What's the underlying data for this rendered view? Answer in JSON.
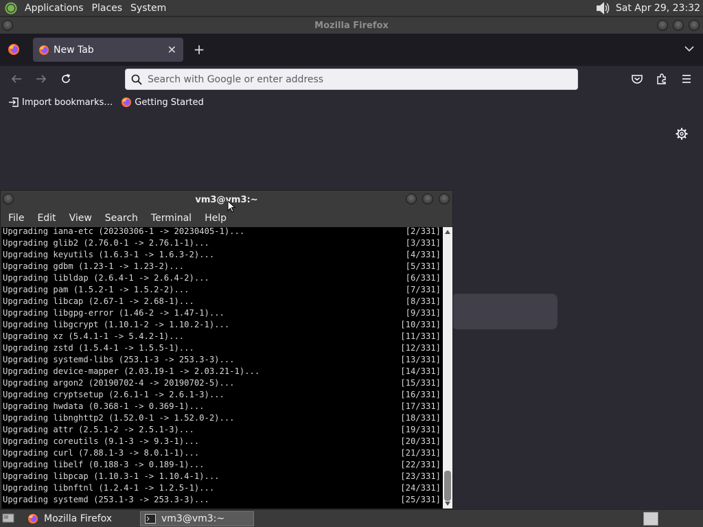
{
  "top_panel": {
    "menus": [
      "Applications",
      "Places",
      "System"
    ],
    "clock": "Sat Apr 29, 23:32"
  },
  "firefox": {
    "window_title": "Mozilla Firefox",
    "tab_label": "New Tab",
    "url_placeholder": "Search with Google or enter address",
    "bookmarks": [
      "Import bookmarks…",
      "Getting Started"
    ]
  },
  "terminal": {
    "window_title": "vm3@vm3:~",
    "menus": [
      "File",
      "Edit",
      "View",
      "Search",
      "Terminal",
      "Help"
    ],
    "lines": [
      {
        "msg": "Upgrading iana-etc (20230306-1 -> 20230405-1)...",
        "count": "[2/331]"
      },
      {
        "msg": "Upgrading glib2 (2.76.0-1 -> 2.76.1-1)...",
        "count": "[3/331]"
      },
      {
        "msg": "Upgrading keyutils (1.6.3-1 -> 1.6.3-2)...",
        "count": "[4/331]"
      },
      {
        "msg": "Upgrading gdbm (1.23-1 -> 1.23-2)...",
        "count": "[5/331]"
      },
      {
        "msg": "Upgrading libldap (2.6.4-1 -> 2.6.4-2)...",
        "count": "[6/331]"
      },
      {
        "msg": "Upgrading pam (1.5.2-1 -> 1.5.2-2)...",
        "count": "[7/331]"
      },
      {
        "msg": "Upgrading libcap (2.67-1 -> 2.68-1)...",
        "count": "[8/331]"
      },
      {
        "msg": "Upgrading libgpg-error (1.46-2 -> 1.47-1)...",
        "count": "[9/331]"
      },
      {
        "msg": "Upgrading libgcrypt (1.10.1-2 -> 1.10.2-1)...",
        "count": "[10/331]"
      },
      {
        "msg": "Upgrading xz (5.4.1-1 -> 5.4.2-1)...",
        "count": "[11/331]"
      },
      {
        "msg": "Upgrading zstd (1.5.4-1 -> 1.5.5-1)...",
        "count": "[12/331]"
      },
      {
        "msg": "Upgrading systemd-libs (253.1-3 -> 253.3-3)...",
        "count": "[13/331]"
      },
      {
        "msg": "Upgrading device-mapper (2.03.19-1 -> 2.03.21-1)...",
        "count": "[14/331]"
      },
      {
        "msg": "Upgrading argon2 (20190702-4 -> 20190702-5)...",
        "count": "[15/331]"
      },
      {
        "msg": "Upgrading cryptsetup (2.6.1-1 -> 2.6.1-3)...",
        "count": "[16/331]"
      },
      {
        "msg": "Upgrading hwdata (0.368-1 -> 0.369-1)...",
        "count": "[17/331]"
      },
      {
        "msg": "Upgrading libnghttp2 (1.52.0-1 -> 1.52.0-2)...",
        "count": "[18/331]"
      },
      {
        "msg": "Upgrading attr (2.5.1-2 -> 2.5.1-3)...",
        "count": "[19/331]"
      },
      {
        "msg": "Upgrading coreutils (9.1-3 -> 9.3-1)...",
        "count": "[20/331]"
      },
      {
        "msg": "Upgrading curl (7.88.1-3 -> 8.0.1-1)...",
        "count": "[21/331]"
      },
      {
        "msg": "Upgrading libelf (0.188-3 -> 0.189-1)...",
        "count": "[22/331]"
      },
      {
        "msg": "Upgrading libpcap (1.10.3-1 -> 1.10.4-1)...",
        "count": "[23/331]"
      },
      {
        "msg": "Upgrading libnftnl (1.2.4-1 -> 1.2.5-1)...",
        "count": "[24/331]"
      },
      {
        "msg": "Upgrading systemd (253.1-3 -> 253.3-3)...",
        "count": "[25/331]"
      }
    ]
  },
  "taskbar": {
    "tasks": [
      "Mozilla Firefox",
      "vm3@vm3:~"
    ]
  },
  "colors": {
    "firefox_bg": "#2b2a33",
    "tab_active": "#42414d",
    "terminal_bg": "#000000",
    "terminal_fg": "#d9d9d9",
    "panel_bg": "#3a3a3a"
  }
}
